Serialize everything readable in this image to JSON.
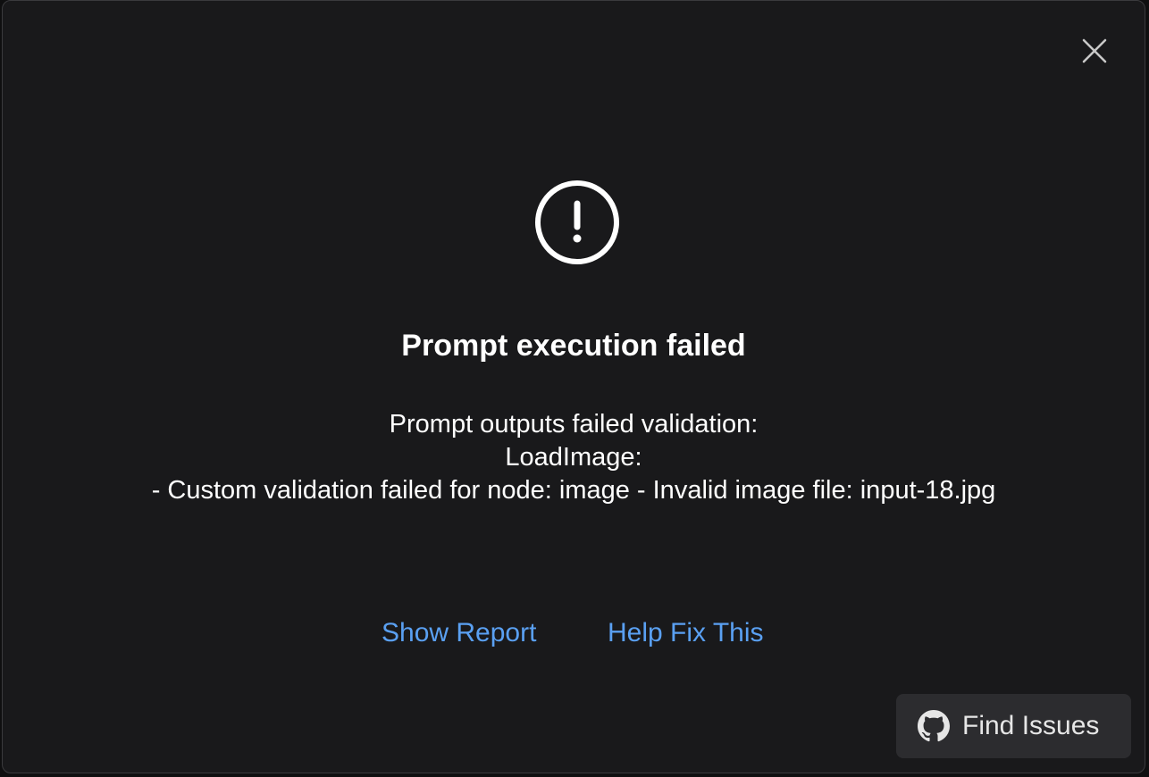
{
  "dialog": {
    "title": "Prompt execution failed",
    "message_lines": [
      "Prompt outputs failed validation:",
      "LoadImage:",
      "- Custom validation failed for node: image - Invalid image file: input-18.jpg"
    ],
    "icons": {
      "close": "close-icon",
      "alert": "exclamation-circle-icon",
      "github": "github-icon"
    }
  },
  "actions": {
    "show_report": "Show Report",
    "help_fix": "Help Fix This",
    "find_issues": "Find Issues"
  },
  "colors": {
    "background": "#19191b",
    "link": "#5aa0f2",
    "button_bg": "#2c2c2f"
  }
}
